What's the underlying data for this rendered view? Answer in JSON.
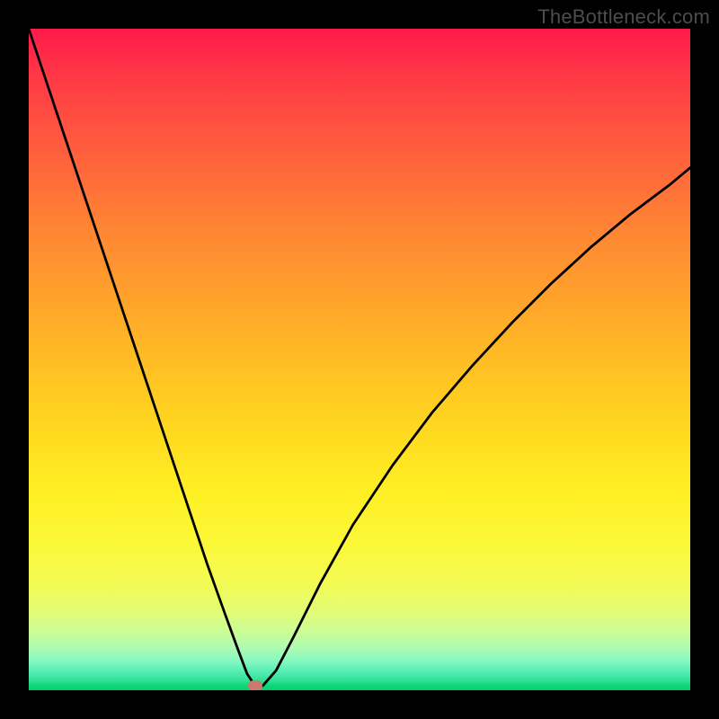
{
  "watermark": "TheBottleneck.com",
  "canvas": {
    "widthPx": 800,
    "heightPx": 800
  },
  "plotArea": {
    "leftPx": 32,
    "topPx": 32,
    "widthPx": 736,
    "heightPx": 736
  },
  "marker": {
    "xPct": 34.2,
    "yPct": 99.3,
    "color": "#c97a6e"
  },
  "gradientStops": [
    {
      "pct": 0,
      "color": "#ff1a4a"
    },
    {
      "pct": 7,
      "color": "#ff3746"
    },
    {
      "pct": 14,
      "color": "#ff5040"
    },
    {
      "pct": 22,
      "color": "#ff6a3a"
    },
    {
      "pct": 30,
      "color": "#ff8434"
    },
    {
      "pct": 38,
      "color": "#ff9b2e"
    },
    {
      "pct": 46,
      "color": "#ffb127"
    },
    {
      "pct": 54,
      "color": "#ffc722"
    },
    {
      "pct": 62,
      "color": "#ffdc20"
    },
    {
      "pct": 70,
      "color": "#ffef24"
    },
    {
      "pct": 78,
      "color": "#fbf838"
    },
    {
      "pct": 84,
      "color": "#f2fb55"
    },
    {
      "pct": 88,
      "color": "#e3fc75"
    },
    {
      "pct": 91,
      "color": "#ccfd94"
    },
    {
      "pct": 93.5,
      "color": "#aefcb0"
    },
    {
      "pct": 95.5,
      "color": "#87f9c1"
    },
    {
      "pct": 97,
      "color": "#5deeb6"
    },
    {
      "pct": 98.4,
      "color": "#32e398"
    },
    {
      "pct": 99.2,
      "color": "#11d87c"
    },
    {
      "pct": 100,
      "color": "#03cf6e"
    }
  ],
  "chart_data": {
    "type": "line",
    "title": "",
    "xlabel": "",
    "ylabel": "",
    "notes": "Bottleneck-style V curve; axes unlabeled. X in percent of plot width, Y in percent (0 top, 100 bottom). Values estimated from pixels.",
    "xlim": [
      0,
      100
    ],
    "ylim": [
      0,
      100
    ],
    "series": [
      {
        "name": "curve",
        "x": [
          0,
          3,
          6,
          9,
          12,
          15,
          18,
          21,
          24,
          27,
          29.5,
          31.5,
          33,
          34.2,
          35.4,
          37.4,
          40,
          44,
          49,
          55,
          61,
          67,
          73,
          79,
          85,
          91,
          97,
          100
        ],
        "y": [
          0,
          9,
          18,
          27,
          36,
          45,
          54,
          63,
          72,
          81,
          88,
          93.5,
          97.5,
          99.3,
          99.3,
          97,
          92,
          84,
          75,
          66,
          58,
          51,
          44.5,
          38.5,
          33,
          28,
          23.5,
          21
        ]
      }
    ]
  }
}
